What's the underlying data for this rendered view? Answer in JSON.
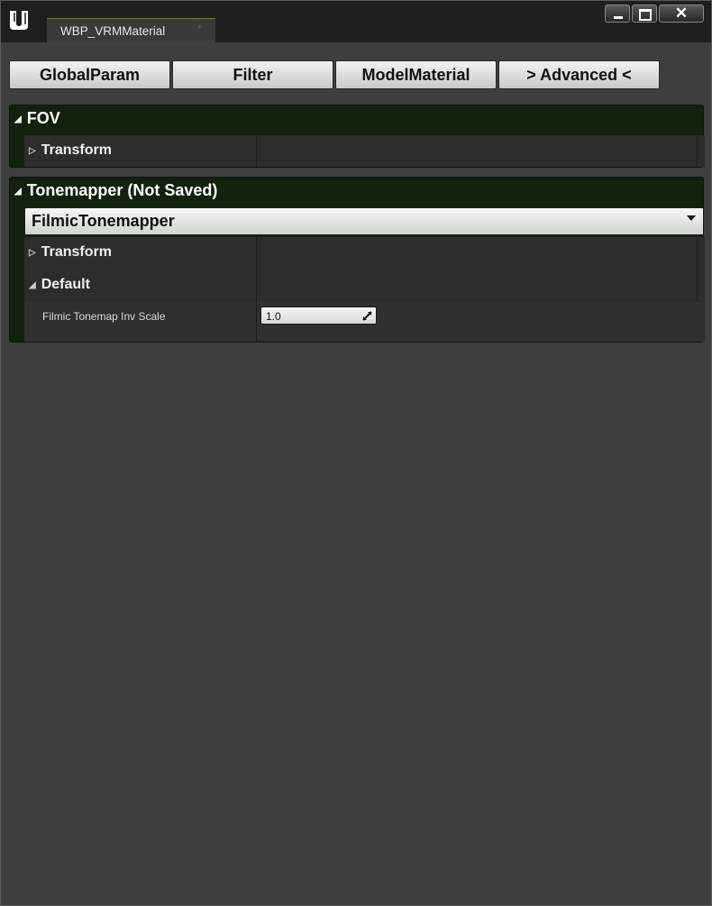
{
  "window": {
    "tab_title": "WBP_VRMMaterial",
    "tab_close": "*",
    "close_glyph": "✕",
    "logo_icon": "unreal-engine-logo-icon"
  },
  "nav": {
    "buttons": [
      "GlobalParam",
      "Filter",
      "ModelMaterial",
      "> Advanced <"
    ]
  },
  "fov": {
    "title": "FOV",
    "transform_label": "Transform"
  },
  "tonemapper": {
    "title": "Tonemapper (Not Saved)",
    "selected": "FilmicTonemapper",
    "transform_label": "Transform",
    "default_label": "Default",
    "property_label": "Filmic Tonemap Inv Scale",
    "property_value": "1.0"
  },
  "colors": {
    "panel_bg": "#13210f",
    "window_bg": "#3e3e3e",
    "titlebar_bg": "#1f1f1f"
  }
}
